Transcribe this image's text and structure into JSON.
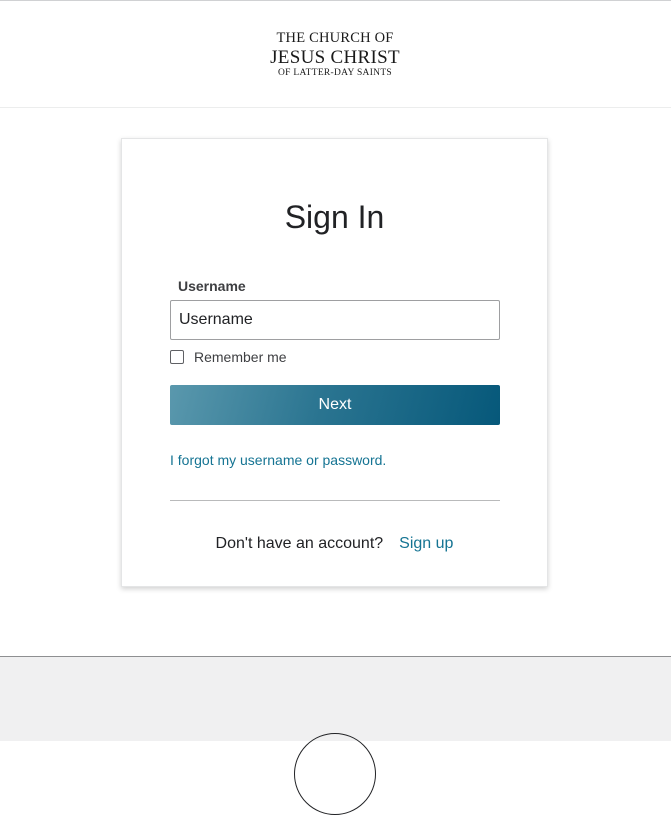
{
  "header": {
    "logo": {
      "line1": "THE CHURCH OF",
      "line2": "JESUS CHRIST",
      "line3": "OF LATTER-DAY SAINTS"
    }
  },
  "signin": {
    "title": "Sign In",
    "username_label": "Username",
    "username_placeholder": "Username",
    "username_value": "",
    "remember_label": "Remember me",
    "remember_checked": false,
    "next_label": "Next",
    "forgot_link": "I forgot my username or password.",
    "no_account_text": "Don't have an account?",
    "signup_link": "Sign up"
  },
  "colors": {
    "accent": "#157493",
    "button_dark": "#06587a",
    "button_light": "#5a98ad",
    "footer_bg": "#f0f0f1"
  },
  "icons": {
    "footer": "circle-emblem-icon"
  }
}
